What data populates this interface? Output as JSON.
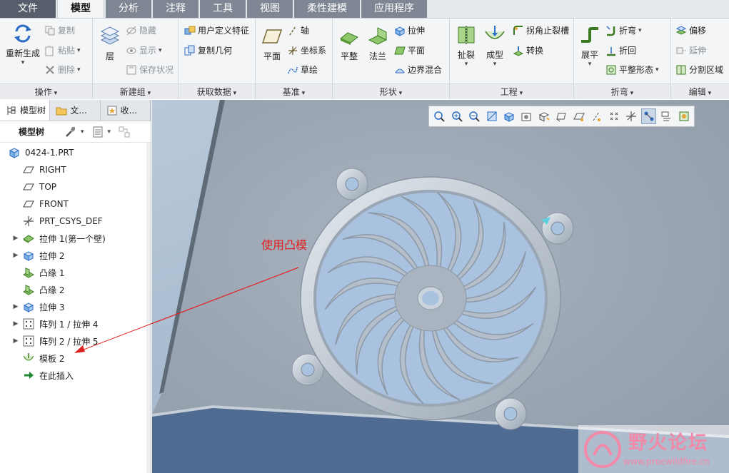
{
  "menu": {
    "tabs": [
      "文件",
      "模型",
      "分析",
      "注释",
      "工具",
      "视图",
      "柔性建模",
      "应用程序"
    ],
    "active_index": 1
  },
  "ribbon": {
    "operations": {
      "label": "操作",
      "regenerate": "重新生成",
      "copy": "复制",
      "paste": "粘贴",
      "delete": "删除"
    },
    "new_group": {
      "label": "新建组",
      "layer": "层",
      "hide": "隐藏",
      "show": "显示",
      "save_state": "保存状况"
    },
    "get_data": {
      "label": "获取数据",
      "udf": "用户定义特征",
      "copy_geom": "复制几何"
    },
    "datum": {
      "label": "基准",
      "plane": "平面",
      "axis": "轴",
      "csys": "坐标系",
      "sketch": "草绘"
    },
    "shapes": {
      "label": "形状",
      "flat": "平整",
      "flange": "法兰",
      "extrude": "拉伸",
      "planar": "平面",
      "boundary_blend": "边界混合"
    },
    "engineering": {
      "label": "工程",
      "rip": "扯裂",
      "form": "成型",
      "corner_relief": "拐角止裂槽",
      "convert": "转换"
    },
    "bends": {
      "label": "折弯",
      "unbend": "展平",
      "bend": "折弯",
      "bend_back": "折回",
      "flatten_form": "平整形态"
    },
    "editing": {
      "label": "编辑",
      "offset": "偏移",
      "extend": "延伸",
      "split_area": "分割区域"
    }
  },
  "panel": {
    "tabs": [
      "模型树",
      "文...",
      "收..."
    ],
    "toolbar_label": "模型树",
    "tree": [
      {
        "label": "0424-1.PRT",
        "icon": "part-icon",
        "expandable": false
      },
      {
        "label": "RIGHT",
        "icon": "datum-plane-icon",
        "expandable": false
      },
      {
        "label": "TOP",
        "icon": "datum-plane-icon",
        "expandable": false
      },
      {
        "label": "FRONT",
        "icon": "datum-plane-icon",
        "expandable": false
      },
      {
        "label": "PRT_CSYS_DEF",
        "icon": "csys-icon",
        "expandable": false
      },
      {
        "label": "拉伸 1(第一个壁)",
        "icon": "first-wall-icon",
        "expandable": true
      },
      {
        "label": "拉伸 2",
        "icon": "extrude-icon",
        "expandable": true
      },
      {
        "label": "凸缘 1",
        "icon": "flange-icon",
        "expandable": false
      },
      {
        "label": "凸缘 2",
        "icon": "flange-icon",
        "expandable": false
      },
      {
        "label": "拉伸 3",
        "icon": "extrude-icon",
        "expandable": true
      },
      {
        "label": "阵列 1 / 拉伸 4",
        "icon": "pattern-icon",
        "expandable": true
      },
      {
        "label": "阵列 2 / 拉伸 5",
        "icon": "pattern-icon",
        "expandable": true
      },
      {
        "label": "模板 2",
        "icon": "form-icon",
        "expandable": false
      },
      {
        "label": "在此插入",
        "icon": "insert-here-icon",
        "expandable": false
      }
    ]
  },
  "viewport": {
    "annotation": "使用凸模",
    "annotation_color": "#e02020"
  },
  "watermark": {
    "title": "野火论坛",
    "url": "www.proewildfire.cn"
  },
  "colors": {
    "accent": "#3a78c2",
    "tab_inactive": "#7f8794",
    "viewport_bg": "#a6b9cd"
  }
}
